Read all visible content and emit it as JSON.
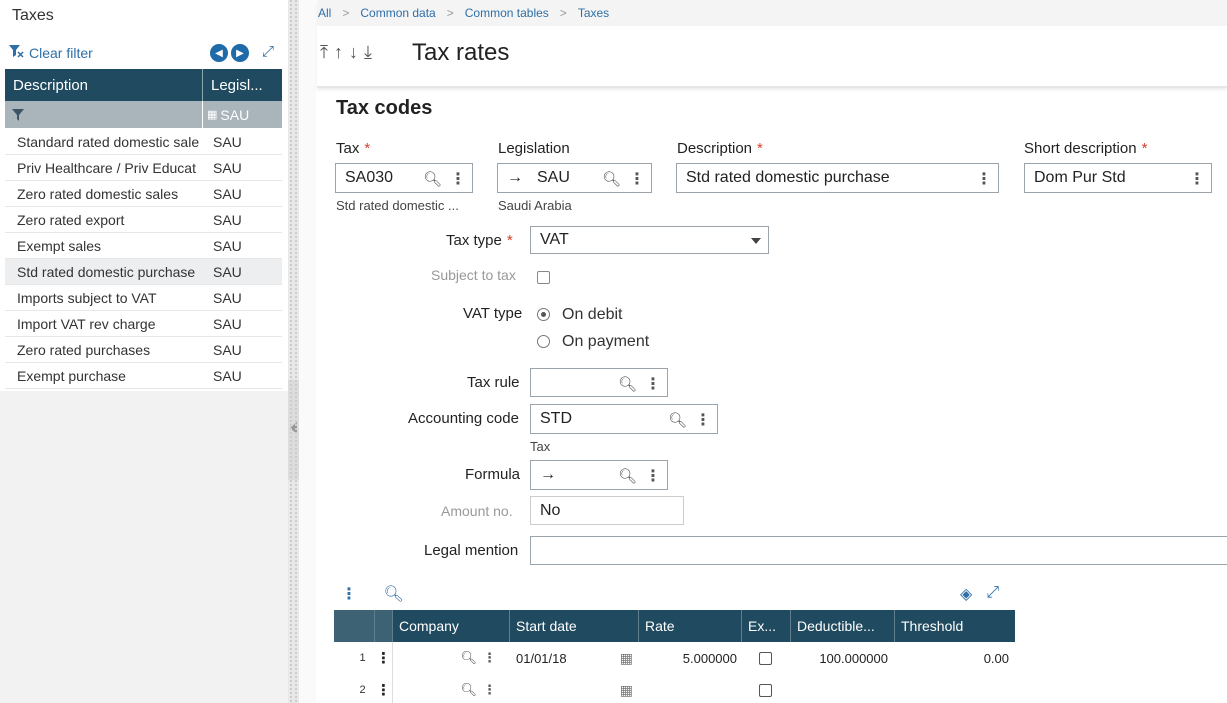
{
  "left_panel": {
    "title": "Taxes",
    "clear_filter": "Clear filter",
    "columns": [
      "Description",
      "Legisl..."
    ],
    "filter_value": "SAU",
    "rows": [
      {
        "description": "Standard rated domestic sale",
        "legislation": "SAU"
      },
      {
        "description": "Priv Healthcare / Priv Educat",
        "legislation": "SAU"
      },
      {
        "description": "Zero rated domestic sales",
        "legislation": "SAU"
      },
      {
        "description": "Zero rated export",
        "legislation": "SAU"
      },
      {
        "description": "Exempt sales",
        "legislation": "SAU"
      },
      {
        "description": "Std rated domestic purchase",
        "legislation": "SAU"
      },
      {
        "description": "Imports subject to VAT",
        "legislation": "SAU"
      },
      {
        "description": "Import VAT rev charge",
        "legislation": "SAU"
      },
      {
        "description": "Zero rated purchases",
        "legislation": "SAU"
      },
      {
        "description": "Exempt purchase",
        "legislation": "SAU"
      }
    ],
    "selected_index": 5
  },
  "breadcrumb": [
    "All",
    "Common data",
    "Common tables",
    "Taxes"
  ],
  "page_title": "Tax rates",
  "section_title": "Tax codes",
  "form": {
    "tax": {
      "label": "Tax",
      "value": "SA030",
      "sub": "Std rated domestic ..."
    },
    "legislation": {
      "label": "Legislation",
      "value": "SAU",
      "sub": "Saudi Arabia"
    },
    "description": {
      "label": "Description",
      "value": "Std rated domestic purchase"
    },
    "short_description": {
      "label": "Short description",
      "value": "Dom Pur Std"
    },
    "tax_type": {
      "label": "Tax type",
      "value": "VAT"
    },
    "subject_to_tax": {
      "label": "Subject to tax",
      "checked": false
    },
    "vat_type": {
      "label": "VAT type",
      "options": [
        "On debit",
        "On payment"
      ],
      "selected": "On debit"
    },
    "tax_rule": {
      "label": "Tax rule",
      "value": ""
    },
    "accounting_code": {
      "label": "Accounting code",
      "value": "STD",
      "sub": "Tax"
    },
    "formula": {
      "label": "Formula",
      "value": ""
    },
    "amount_no": {
      "label": "Amount no.",
      "value": "No"
    },
    "legal_mention": {
      "label": "Legal mention",
      "value": ""
    }
  },
  "grid": {
    "columns": [
      "Company",
      "Start date",
      "Rate",
      "Ex...",
      "Deductible...",
      "Threshold"
    ],
    "rows": [
      {
        "n": "1",
        "company": "",
        "start_date": "01/01/18",
        "rate": "5.000000",
        "exempt": false,
        "deductible": "100.000000",
        "threshold": "0.00"
      },
      {
        "n": "2",
        "company": "",
        "start_date": "",
        "rate": "",
        "exempt": false,
        "deductible": "",
        "threshold": ""
      }
    ]
  },
  "colors": {
    "header_bg": "#1f4a5f",
    "link": "#2f6fa6",
    "required": "#d9402c"
  }
}
